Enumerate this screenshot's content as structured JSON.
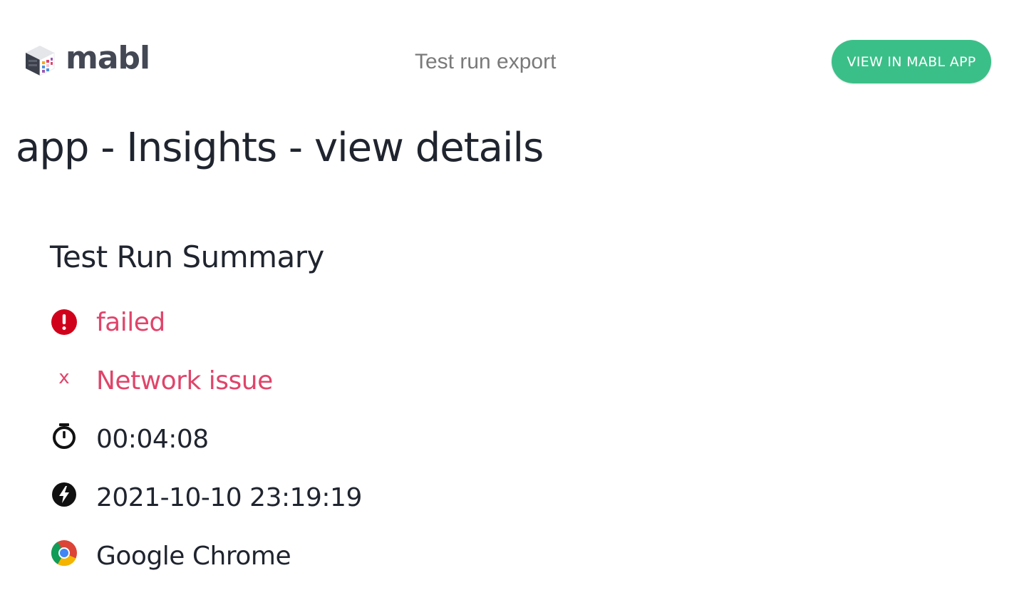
{
  "header": {
    "logo_text": "mabl",
    "title": "Test run export",
    "view_button_label": "VIEW IN MABL APP"
  },
  "page": {
    "title": "app - Insights - view details"
  },
  "summary": {
    "heading": "Test Run Summary",
    "status": "failed",
    "failure_reason": "Network issue",
    "duration": "00:04:08",
    "start_time": "2021-10-10 23:19:19",
    "browser": "Google Chrome"
  },
  "icons": {
    "status": "alert-circle-icon",
    "failure_reason": "x-icon",
    "duration": "stopwatch-icon",
    "start_time": "lightning-bolt-icon",
    "browser": "chrome-icon"
  },
  "colors": {
    "accent": "#3bbf88",
    "error": "#e0446a",
    "error_icon": "#d0021b",
    "text": "#1f242e",
    "muted": "#7a7a7a"
  }
}
